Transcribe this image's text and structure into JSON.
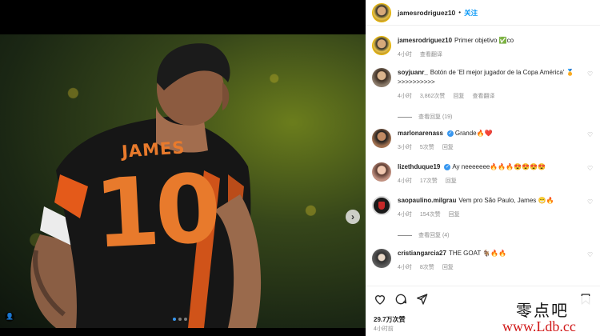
{
  "post": {
    "author": "jamesrodriguez10",
    "follow_label": "关注",
    "header_sep": "•"
  },
  "caption": {
    "author": "jamesrodriguez10",
    "text": "Primer objetivo ✅co",
    "time": "4小时",
    "translate": "查看翻译"
  },
  "comments": [
    {
      "user": "soyjuanr_",
      "text": "Botón de 'El mejor jugador de la Copa América' 🏅>>>>>>>>>>",
      "time": "4小时",
      "likes": "3,862次赞",
      "reply": "回复",
      "translate": "查看翻译",
      "more": "查看回复 (19)"
    },
    {
      "user": "marlonarenass",
      "verified": "✓",
      "text": "Grande🔥❤️",
      "time": "3小时",
      "likes": "5次赞",
      "reply": "回复"
    },
    {
      "user": "lizethduque19",
      "verified": "✓",
      "text": "Ay neeeeeee🔥🔥🔥😍😍😍😍",
      "time": "4小时",
      "likes": "17次赞",
      "reply": "回复"
    },
    {
      "user": "saopaulino.milgrau",
      "text": "Vem pro São Paulo, James 😁🔥",
      "time": "4小时",
      "likes": "154次赞",
      "reply": "回复",
      "more": "查看回复 (4)"
    },
    {
      "user": "cristiangarcia27",
      "text": "THE GOAT 🐐🔥🔥",
      "time": "4小时",
      "likes": "8次赞",
      "reply": "回复"
    }
  ],
  "photo": {
    "jersey_name": "JAMES",
    "jersey_number": "10"
  },
  "footer": {
    "likes": "29.7万次赞",
    "ago": "4小时前"
  },
  "watermark": {
    "cn": "零点吧",
    "url": "www.Ldb.cc"
  },
  "icons": {
    "next": "›",
    "heart": "♡",
    "tag": "👤"
  }
}
